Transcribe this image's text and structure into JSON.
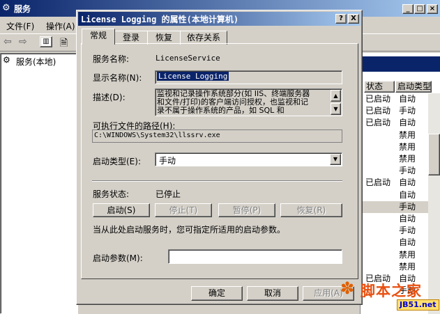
{
  "bg_window": {
    "title": "服务",
    "menu": [
      "文件(F)",
      "操作(A)"
    ],
    "tree_item": "服务(本地)",
    "columns": {
      "status": "状态",
      "startup": "启动类型"
    },
    "rows": [
      {
        "status": "已启动",
        "startup": "自动"
      },
      {
        "status": "已启动",
        "startup": "手动"
      },
      {
        "status": "已启动",
        "startup": "自动"
      },
      {
        "status": "",
        "startup": "禁用"
      },
      {
        "status": "",
        "startup": "禁用"
      },
      {
        "status": "",
        "startup": "禁用"
      },
      {
        "status": "",
        "startup": "手动"
      },
      {
        "status": "已启动",
        "startup": "自动"
      },
      {
        "status": "",
        "startup": "自动"
      },
      {
        "status": "",
        "startup": "手动"
      },
      {
        "status": "",
        "startup": "自动"
      },
      {
        "status": "",
        "startup": "手动"
      },
      {
        "status": "",
        "startup": "自动"
      },
      {
        "status": "",
        "startup": "禁用"
      },
      {
        "status": "",
        "startup": "禁用"
      },
      {
        "status": "已启动",
        "startup": "自动"
      },
      {
        "status": "",
        "startup": "手动"
      }
    ]
  },
  "dialog": {
    "title": "License Logging 的属性(本地计算机)",
    "help_btn": "?",
    "close_btn": "X",
    "tabs": [
      "常规",
      "登录",
      "恢复",
      "依存关系"
    ],
    "service_name_label": "服务名称:",
    "service_name_value": "LicenseService",
    "display_name_label": "显示名称(N):",
    "display_name_value": "License Logging",
    "description_label": "描述(D):",
    "description_lines": [
      "监视和记录操作系统部分(如 IIS、终端服务器",
      "和文件/打印)的客户端访问授权，也监视和记",
      "录不属于操作系统的产品，如 SQL 和"
    ],
    "path_label": "可执行文件的路径(H):",
    "path_value": "C:\\WINDOWS\\System32\\llssrv.exe",
    "startup_type_label": "启动类型(E):",
    "startup_type_value": "手动",
    "service_status_label": "服务状态:",
    "service_status_value": "已停止",
    "buttons": {
      "start": "启动(S)",
      "stop": "停止(T)",
      "pause": "暂停(P)",
      "resume": "恢复(R)"
    },
    "hint": "当从此处启动服务时，您可指定所适用的启动参数。",
    "params_label": "启动参数(M):",
    "params_value": "",
    "ok": "确定",
    "cancel": "取消",
    "apply": "应用(A)"
  },
  "watermark": {
    "text": "脚本之家",
    "url": "JB51.net"
  }
}
